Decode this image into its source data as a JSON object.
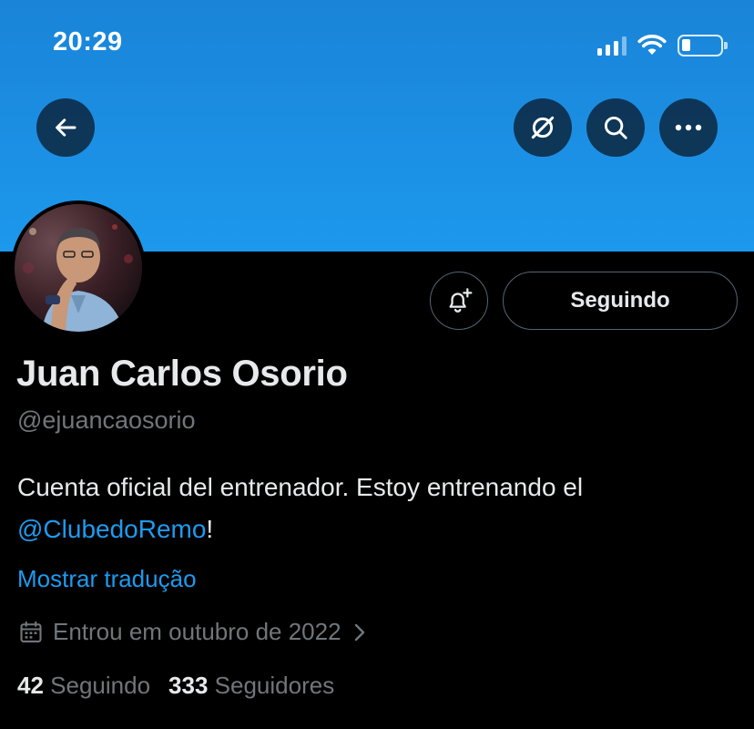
{
  "status_bar": {
    "time": "20:29",
    "signal_icon": "cellular-signal-icon",
    "wifi_icon": "wifi-icon",
    "battery_icon": "battery-low-icon",
    "battery_level": 0.2
  },
  "header": {
    "back_icon": "arrow-left-icon",
    "grok_icon": "grok-icon",
    "search_icon": "search-icon",
    "more_icon": "more-horizontal-icon",
    "banner_color": "#1d9bf0"
  },
  "profile": {
    "avatar_alt": "avatar",
    "notify_icon": "bell-plus-icon",
    "follow_label": "Seguindo",
    "display_name": "Juan Carlos Osorio",
    "handle": "@ejuancaosorio",
    "bio_text": "Cuenta oficial del entrenador. Estoy entrenando el ",
    "bio_mention": "@ClubedoRemo",
    "bio_suffix": "!",
    "translate_label": "Mostrar tradução",
    "calendar_icon": "calendar-icon",
    "joined_text": "Entrou em outubro de 2022",
    "chevron_icon": "chevron-right-icon",
    "following_count": "42",
    "following_label": "Seguindo",
    "followers_count": "333",
    "followers_label": "Seguidores"
  },
  "colors": {
    "accent": "#1d9bf0",
    "background": "#000000",
    "text_primary": "#e7e9ea",
    "text_secondary": "#71767b",
    "border": "#536471"
  }
}
